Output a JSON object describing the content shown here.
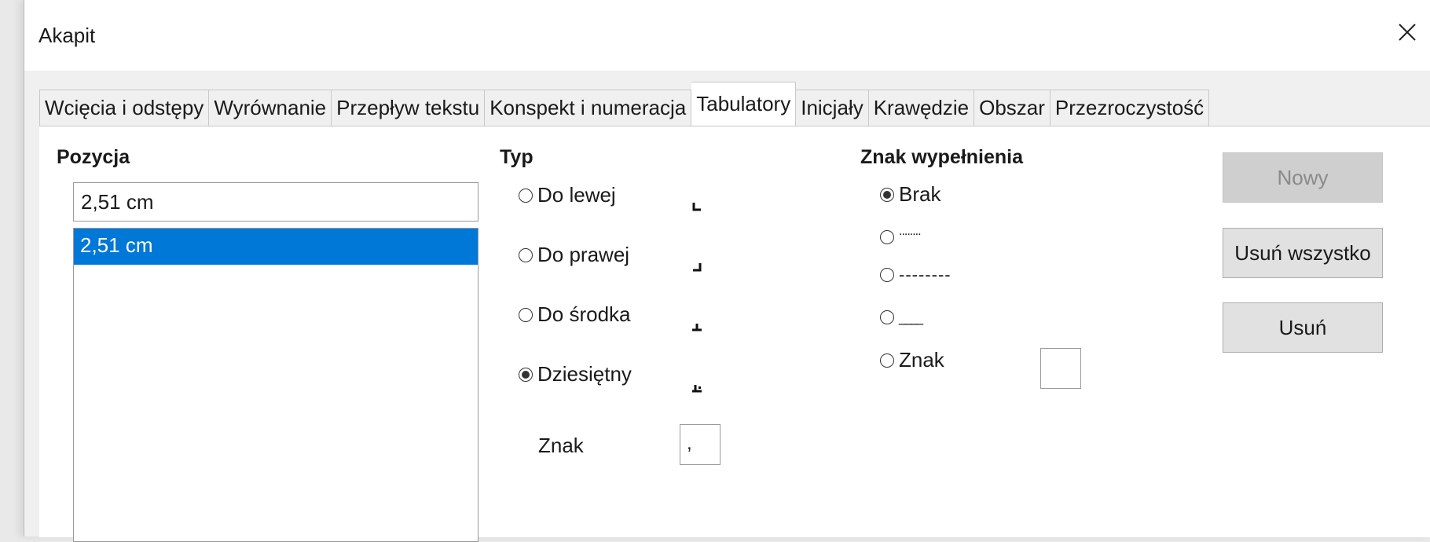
{
  "window": {
    "title": "Akapit"
  },
  "tabs": [
    {
      "label": "Wcięcia i odstępy"
    },
    {
      "label": "Wyrównanie"
    },
    {
      "label": "Przepływ tekstu"
    },
    {
      "label": "Konspekt i numeracja"
    },
    {
      "label": "Tabulatory",
      "active": true
    },
    {
      "label": "Inicjały"
    },
    {
      "label": "Krawędzie"
    },
    {
      "label": "Obszar"
    },
    {
      "label": "Przezroczystość"
    }
  ],
  "position": {
    "heading": "Pozycja",
    "input_value": "2,51 cm",
    "list": [
      "2,51 cm"
    ]
  },
  "type": {
    "heading": "Typ",
    "options": [
      {
        "label": "Do lewej",
        "selected": false,
        "glyph": "tab-left-icon"
      },
      {
        "label": "Do prawej",
        "selected": false,
        "glyph": "tab-right-icon"
      },
      {
        "label": "Do środka",
        "selected": false,
        "glyph": "tab-center-icon"
      },
      {
        "label": "Dziesiętny",
        "selected": true,
        "glyph": "tab-decimal-icon"
      }
    ],
    "char_label": "Znak",
    "char_value": ","
  },
  "fill": {
    "heading": "Znak wypełnienia",
    "options": [
      {
        "label": "Brak",
        "selected": true
      },
      {
        "label": "........",
        "selected": false
      },
      {
        "label": "--------",
        "selected": false
      },
      {
        "label": "____",
        "selected": false
      },
      {
        "label": "Znak",
        "selected": false
      }
    ],
    "char_value": ""
  },
  "buttons": {
    "new": "Nowy",
    "delete_all": "Usuń wszystko",
    "delete": "Usuń"
  }
}
